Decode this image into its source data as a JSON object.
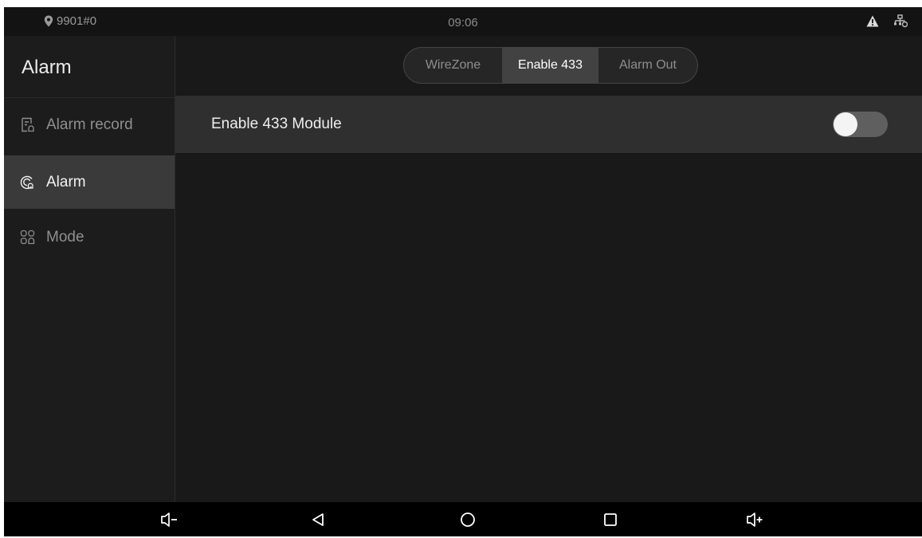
{
  "status_bar": {
    "location_icon": "location-pin-icon",
    "location_text": "9901#0",
    "time": "09:06",
    "icons": [
      "warning-icon",
      "network-icon"
    ]
  },
  "sidebar": {
    "title": "Alarm",
    "items": [
      {
        "label": "Alarm record",
        "icon": "alarm-record-icon",
        "active": false
      },
      {
        "label": "Alarm",
        "icon": "alarm-icon",
        "active": true
      },
      {
        "label": "Mode",
        "icon": "mode-grid-icon",
        "active": false
      }
    ]
  },
  "tabs": [
    {
      "label": "WireZone",
      "active": false
    },
    {
      "label": "Enable 433",
      "active": true
    },
    {
      "label": "Alarm Out",
      "active": false
    }
  ],
  "settings": {
    "enable_433_label": "Enable 433 Module",
    "enable_433_on": false
  },
  "nav_bar": {
    "icons": [
      "volume-down-icon",
      "back-icon",
      "home-icon",
      "recents-icon",
      "volume-up-icon"
    ]
  },
  "colors": {
    "background": "#181818",
    "sidebar_active": "#3a3a3a",
    "row_background": "#2f2f2f",
    "toggle_off": "#5f5f5f"
  }
}
